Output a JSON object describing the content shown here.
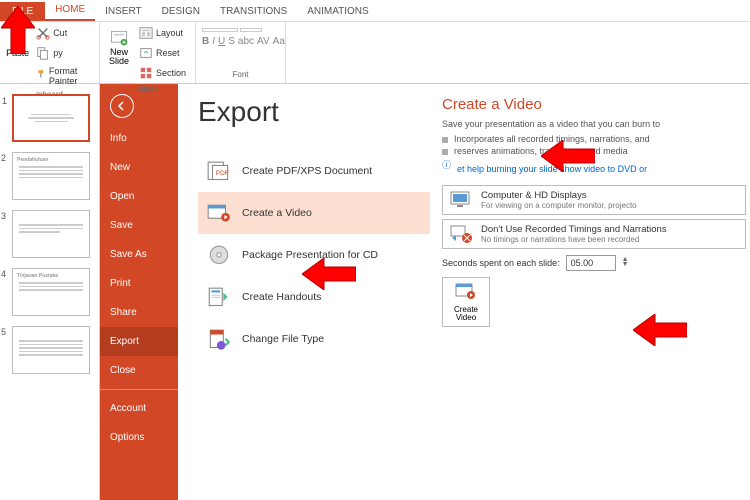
{
  "ribbon": {
    "tabs": {
      "file": "FILE",
      "home": "HOME",
      "insert": "INSERT",
      "design": "DESIGN",
      "transitions": "TRANSITIONS",
      "animations": "ANIMATIONS"
    },
    "clipboard": {
      "label": "ipboard",
      "cut": "Cut",
      "copy": "py",
      "fp": "Format Painter",
      "paste": "Paste"
    },
    "slides": {
      "label": "Slides",
      "new": "New Slide",
      "layout": "Layout",
      "reset": "Reset",
      "section": "Section"
    },
    "font": {
      "label": "Font"
    }
  },
  "thumbs": {
    "t1": "1",
    "t2": "2",
    "t2title": "Pendahuluan",
    "t3": "3",
    "t4": "4",
    "t4title": "Tinjauan Pustaka",
    "t5": "5"
  },
  "file_menu": {
    "info": "Info",
    "new": "New",
    "open": "Open",
    "save": "Save",
    "saveas": "Save As",
    "print": "Print",
    "share": "Share",
    "export": "Export",
    "close": "Close",
    "account": "Account",
    "options": "Options"
  },
  "export": {
    "title": "Export",
    "items": {
      "pdf": "Create PDF/XPS Document",
      "video": "Create a Video",
      "cd": "Package Presentation for CD",
      "handouts": "Create Handouts",
      "filetype": "Change File Type"
    },
    "cv": {
      "title": "Create a Video",
      "desc": "Save your presentation as a video that you can burn to",
      "l1": "Incorporates all recorded timings, narrations, and",
      "l2": "reserves animations, transitions, and media",
      "link": "et help burning your slide show video to DVD or",
      "opt1t": "Computer & HD Displays",
      "opt1s": "For viewing on a computer monitor, projecto",
      "opt2t": "Don't Use Recorded Timings and Narrations",
      "opt2s": "No timings or narrations have been recorded",
      "sec_lbl": "Seconds spent on each slide:",
      "sec_val": "05.00",
      "btn": "Create Video"
    }
  }
}
